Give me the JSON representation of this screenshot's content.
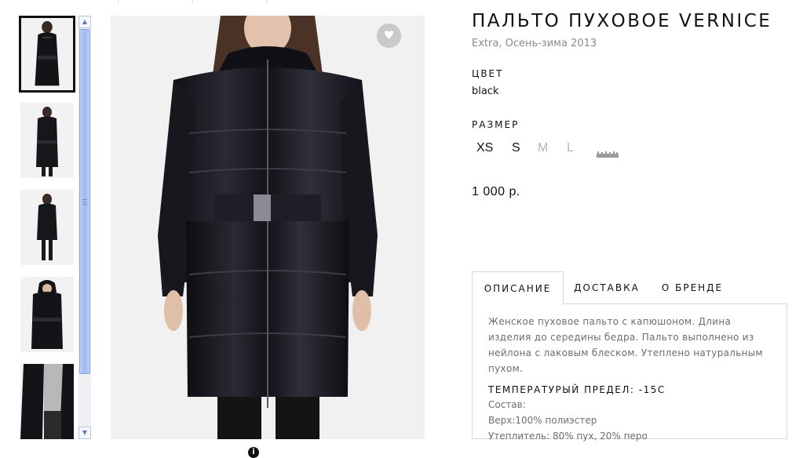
{
  "product": {
    "title": "ПАЛЬТО ПУХОВОЕ VERNICE",
    "subtitle": "Extra, Осень-зима 2013",
    "color_label": "ЦВЕТ",
    "color_value": "black",
    "size_label": "РАЗМЕР",
    "sizes": [
      {
        "label": "XS",
        "available": true
      },
      {
        "label": "S",
        "available": true
      },
      {
        "label": "M",
        "available": false
      },
      {
        "label": "L",
        "available": false
      }
    ],
    "size_chart_icon": "ruler-icon",
    "price": "1 000 р."
  },
  "gallery": {
    "thumbnail_count": 5,
    "active_index": 0,
    "favorite_icon": "heart-icon",
    "info_icon": "info-icon"
  },
  "tabs": [
    {
      "label": "ОПИСАНИЕ",
      "active": true
    },
    {
      "label": "ДОСТАВКА",
      "active": false
    },
    {
      "label": "О БРЕНДЕ",
      "active": false
    }
  ],
  "description": {
    "text": "Женское пуховое пальто с капюшоном. Длина изделия до середины бедра. Пальто выполнено из нейлона с лаковым блеском. Утеплено натуральным пухом.",
    "temperature": "ТЕМПЕРАТУРЫЙ ПРЕДЕЛ: -15С",
    "composition_label": "Состав:",
    "outer": "Верх:100% полиэстер",
    "filling": "Утеплитель: 80% пух, 20% перо"
  },
  "colors": {
    "text": "#111111",
    "muted": "#8a8a8a",
    "unavailable": "#b5b5b5",
    "border": "#d6d6d6",
    "scroll_thumb": "#9fbaf0"
  }
}
